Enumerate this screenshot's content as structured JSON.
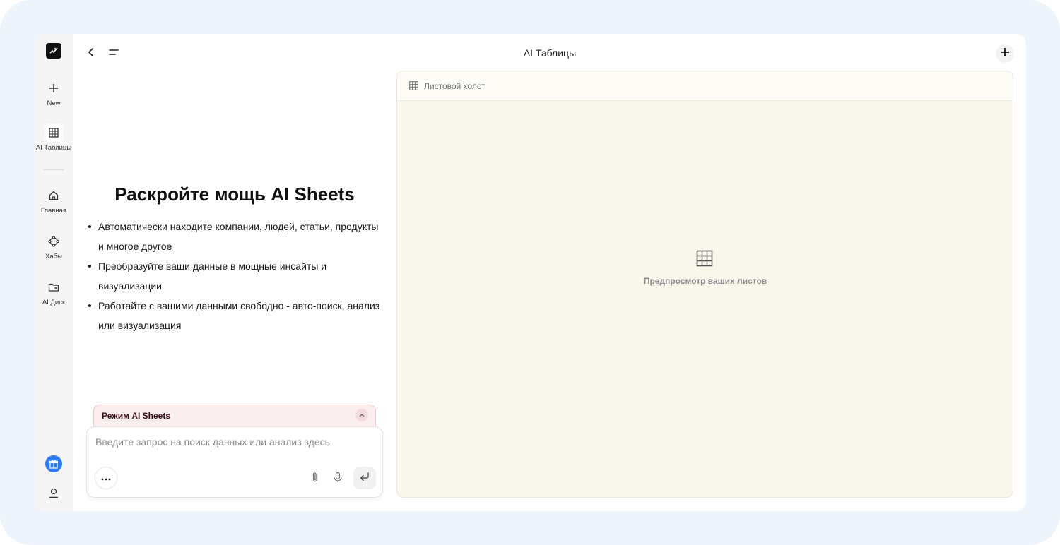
{
  "app": {
    "title": "AI Таблицы"
  },
  "rail": {
    "new_label": "New",
    "sheets_label": "AI Таблицы",
    "home_label": "Главная",
    "hubs_label": "Хабы",
    "drive_label": "AI Диск"
  },
  "hero": {
    "title": "Раскройте мощь AI Sheets",
    "bullets": [
      "Автоматически находите компании, людей, статьи, продукты и многое другое",
      "Преобразуйте ваши данные в мощные инсайты и визуализации",
      "Работайте с вашими данными свободно - авто-поиск, анализ или визуализация"
    ]
  },
  "mode": {
    "label": "Режим AI Sheets"
  },
  "composer": {
    "placeholder": "Введите запрос на поиск данных или анализ здесь",
    "value": ""
  },
  "canvas": {
    "header": "Листовой холст",
    "empty_text": "Предпросмотр ваших листов"
  },
  "colors": {
    "accent_blue": "#2a7bf4",
    "canvas_bg": "#f9f6ec",
    "mode_bg": "#fbeeef",
    "frame_bg": "#eef4fb"
  },
  "icons": [
    "app-logo-icon",
    "plus-icon",
    "grid-icon",
    "home-icon",
    "hub-icon",
    "folder-icon",
    "gift-icon",
    "user-icon",
    "back-icon",
    "menu-icon",
    "chevron-up-icon",
    "more-icon",
    "paperclip-icon",
    "microphone-icon",
    "enter-icon"
  ]
}
